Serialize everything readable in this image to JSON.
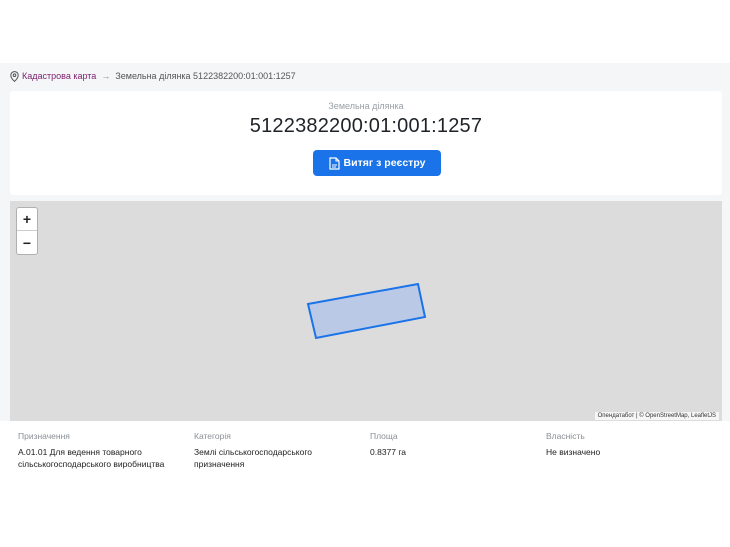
{
  "breadcrumb": {
    "root": "Кадастрова карта",
    "separator": "→",
    "current": "Земельна ділянка 5122382200:01:001:1257"
  },
  "header": {
    "label": "Земельна ділянка",
    "cadastral_number": "5122382200:01:001:1257",
    "extract_button": "Витяг з реєстру"
  },
  "map": {
    "zoom_in": "+",
    "zoom_out": "−",
    "attribution": "Опендатабот | © OpenStreetMap, LeafletJS"
  },
  "details": [
    {
      "key": "Призначення",
      "value": "А.01.01 Для ведення товарного сільськогосподарського виробництва"
    },
    {
      "key": "Категорія",
      "value": "Землі сільськогосподарського призначення"
    },
    {
      "key": "Площа",
      "value": "0.8377 га"
    },
    {
      "key": "Власність",
      "value": "Не визначено"
    }
  ],
  "colors": {
    "accent": "#1a73e8",
    "link": "#7a1f6e",
    "parcel_fill": "#b3c6e8",
    "parcel_stroke": "#1a73e8"
  }
}
